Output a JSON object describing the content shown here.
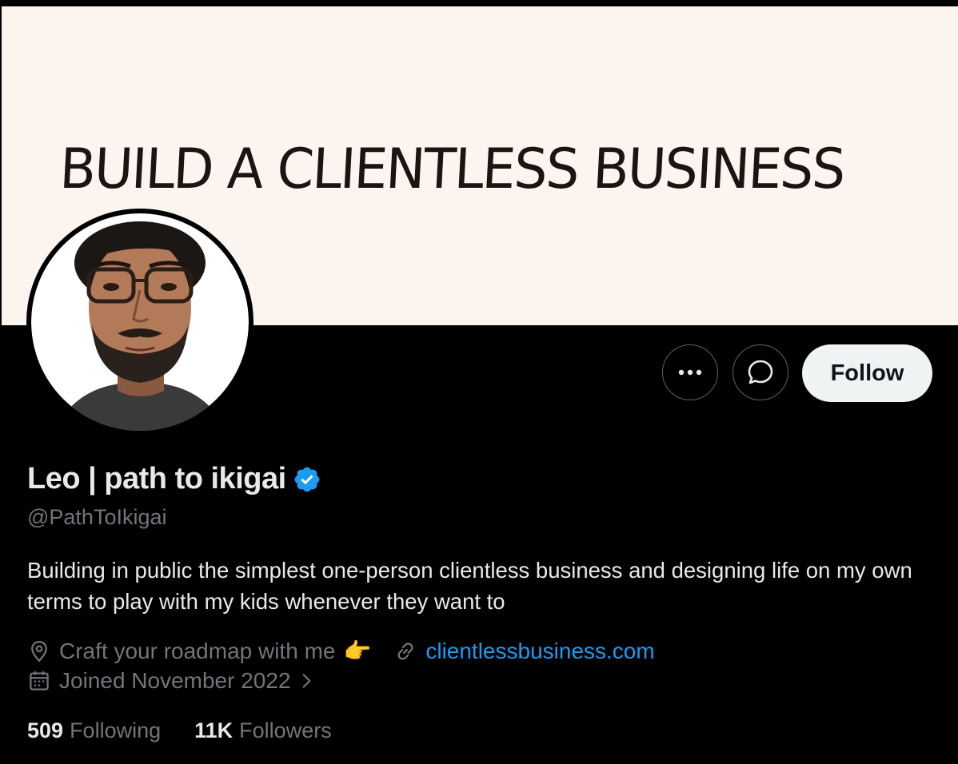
{
  "banner": {
    "text": "BUILD A CLIENTLESS BUSINESS",
    "background": "#fcf4ee"
  },
  "profile": {
    "name": "Leo | path to ikigai",
    "handle": "@PathToIkigai",
    "verified": true,
    "bio": "Building in public the simplest one-person clientless business and designing life on my own terms to play with my kids whenever they want to",
    "location": "Craft your roadmap with me",
    "location_emoji": "👉",
    "website": "clientlessbusiness.com",
    "joined": "Joined November 2022"
  },
  "actions": {
    "more_icon": "more-horizontal-icon",
    "message_icon": "message-icon",
    "follow_label": "Follow"
  },
  "stats": {
    "following_count": "509",
    "following_label": "Following",
    "followers_count": "11K",
    "followers_label": "Followers"
  },
  "colors": {
    "background": "#000000",
    "primary_text": "#e7e9ea",
    "secondary_text": "#71767b",
    "link": "#1d9bf0",
    "verified_badge": "#1d9bf0",
    "follow_button_bg": "#eff3f4"
  }
}
